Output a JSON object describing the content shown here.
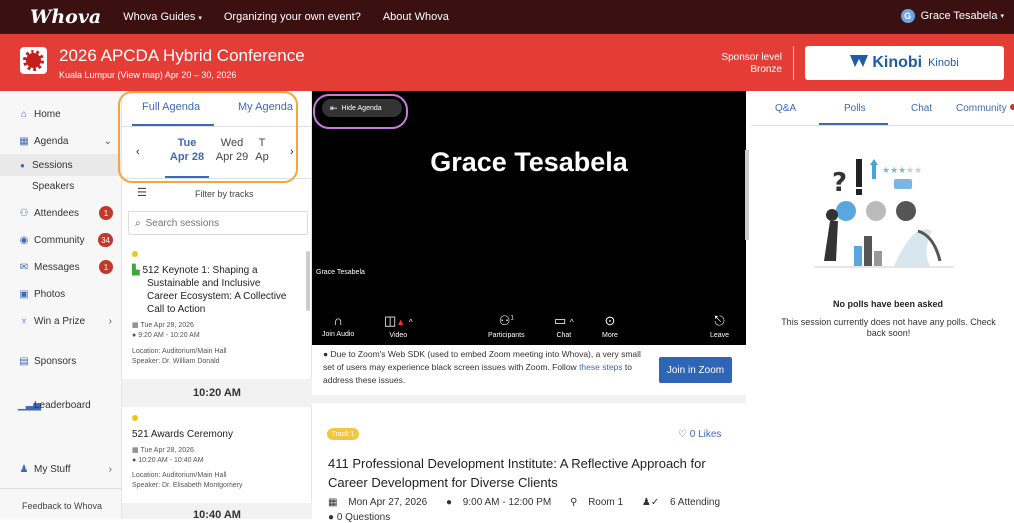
{
  "topbar": {
    "logo": "Whova",
    "nav": [
      {
        "label": "Whova Guides",
        "caret": "▾"
      },
      {
        "label": "Organizing your own event?"
      },
      {
        "label": "About Whova"
      }
    ],
    "user": {
      "initial": "G",
      "name": "Grace Tesabela",
      "caret": "▾"
    }
  },
  "event": {
    "title": "2026 APCDA Hybrid Conference",
    "location": "Kuala Lumpur (View map)  Apr 20 – 30, 2026",
    "sponsor_level_label": "Sponsor level",
    "sponsor_level": "Bronze",
    "sponsor_name": "Kinobi",
    "sponsor_name_small": "Kinobi"
  },
  "sidebar": {
    "items": [
      {
        "label": "Home",
        "icon": "home-icon"
      },
      {
        "label": "Agenda",
        "icon": "calendar-icon"
      },
      {
        "label": "Sessions"
      },
      {
        "label": "Speakers"
      },
      {
        "label": "Attendees",
        "badge": "1",
        "icon": "attendees-icon"
      },
      {
        "label": "Community",
        "badge": "34",
        "icon": "community-icon"
      },
      {
        "label": "Messages",
        "badge": "1",
        "icon": "messages-icon"
      },
      {
        "label": "Photos",
        "icon": "photos-icon"
      },
      {
        "label": "Win a Prize",
        "icon": "trophy-icon"
      },
      {
        "label": "Sponsors",
        "icon": "sponsors-icon"
      },
      {
        "label": "Leaderboard",
        "icon": "leaderboard-icon"
      },
      {
        "label": "My Stuff",
        "icon": "mystuff-icon"
      }
    ],
    "feedback": "Feedback to Whova"
  },
  "agenda": {
    "tabs": [
      "Full Agenda",
      "My Agenda"
    ],
    "days": [
      {
        "dow": "Tue",
        "date": "Apr 28"
      },
      {
        "dow": "Wed",
        "date": "Apr 29"
      },
      {
        "dow": "T",
        "date": "Ap"
      }
    ],
    "filter": "Filter by tracks",
    "search_placeholder": "Search sessions",
    "sessions": [
      {
        "title_lines": [
          "512 Keynote 1: Shaping a",
          "Sustainable and Inclusive",
          "Career Ecosystem: A Collective",
          "Call to Action"
        ],
        "date": "Tue Apr 28, 2026",
        "time": "9:20 AM - 10:20 AM",
        "location": "Location: Auditorium/Main Hall",
        "speaker": "Speaker: Dr. William Donald"
      },
      {
        "title_lines": [
          "521 Awards Ceremony"
        ],
        "date": "Tue Apr 28, 2026",
        "time": "10:20 AM - 10:40 AM",
        "location": "Location: Auditorium/Main Hall",
        "speaker": "Speaker: Dr. Elisabeth Montgomery"
      }
    ],
    "time_headers": [
      "10:20 AM",
      "10:40 AM"
    ]
  },
  "video": {
    "hide_agenda": "Hide Agenda",
    "participant_name": "Grace Tesabela",
    "participant_label": "Grace Tesabela",
    "controls": [
      {
        "label": "Join Audio",
        "icon": "headphones-icon"
      },
      {
        "label": "Video",
        "icon": "video-off-icon"
      },
      {
        "label": "Participants",
        "icon": "participants-icon",
        "count": "1"
      },
      {
        "label": "Chat",
        "icon": "chat-icon"
      },
      {
        "label": "More",
        "icon": "more-icon"
      },
      {
        "label": "Leave",
        "icon": "leave-icon"
      }
    ]
  },
  "notice": {
    "text": "Due to Zoom's Web SDK (used to embed Zoom meeting into Whova), a very small set of users may experience black screen issues with Zoom. Follow",
    "link": "these steps",
    "tail": "to address these issues.",
    "join_button": "Join in Zoom"
  },
  "session_detail": {
    "track": "Track 1",
    "likes": "0 Likes",
    "title": "411 Professional Development Institute: A Reflective Approach for Career Development for Diverse Clients",
    "date": "Mon Apr 27, 2026",
    "time": "9:00 AM - 12:00 PM",
    "room": "Room 1",
    "attending": "6 Attending",
    "questions": "0 Questions"
  },
  "right_panel": {
    "tabs": [
      "Q&A",
      "Polls",
      "Chat",
      "Community"
    ],
    "empty_title": "No polls have been asked",
    "empty_sub": "This session currently does not have any polls. Check back soon!"
  },
  "colors": {
    "topbar": "#3a1010",
    "event_bar": "#e33d35",
    "accent": "#3f69b8",
    "badge": "#c0392b",
    "track": "#f4c542",
    "highlight_orange": "#f4a63a",
    "highlight_purple": "#c77bdc"
  }
}
